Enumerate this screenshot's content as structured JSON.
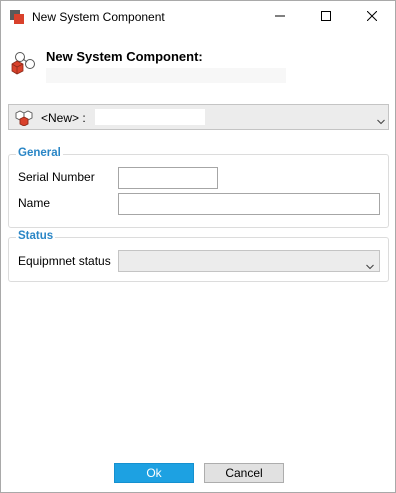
{
  "window": {
    "title": "New System Component",
    "icon": "component-app-icon"
  },
  "titlebar_buttons": {
    "minimize_icon": "minimize-icon",
    "maximize_icon": "maximize-icon",
    "close_icon": "close-icon"
  },
  "header": {
    "title": "New System Component:",
    "icon": "component-icon"
  },
  "selector": {
    "label": "<New> :",
    "value": "",
    "icon": "cubes-icon"
  },
  "general": {
    "title": "General",
    "serial_number_label": "Serial Number",
    "serial_number_value": "",
    "name_label": "Name",
    "name_value": ""
  },
  "status": {
    "title": "Status",
    "equipment_status_label": "Equipmnet status",
    "equipment_status_value": ""
  },
  "buttons": {
    "ok": "Ok",
    "cancel": "Cancel"
  },
  "colors": {
    "accent": "#2a86c6",
    "ok_button": "#1da1e2",
    "icon_red": "#d9412b"
  }
}
